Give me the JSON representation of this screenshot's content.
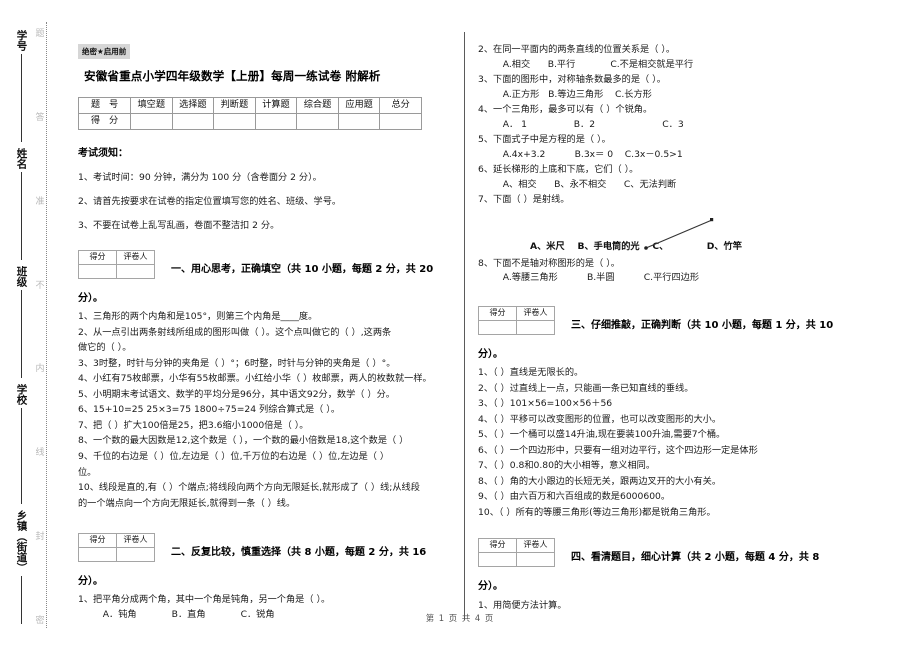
{
  "seal": {
    "faint_chars": [
      "密",
      "封",
      "线",
      "内",
      "不",
      "准",
      "答",
      "题"
    ],
    "fields": [
      {
        "label": "学号"
      },
      {
        "label": "姓名"
      },
      {
        "label": "班级"
      },
      {
        "label": "学校"
      },
      {
        "label": "乡镇（街道）"
      }
    ]
  },
  "header": {
    "secret_badge": "绝密★启用前",
    "title": "安徽省重点小学四年级数学【上册】每周一练试卷 附解析"
  },
  "score_table": {
    "row1_head": "题  号",
    "row2_head": "得  分",
    "columns": [
      "填空题",
      "选择题",
      "判断题",
      "计算题",
      "综合题",
      "应用题",
      "总分"
    ]
  },
  "notice": {
    "title": "考试须知：",
    "items": [
      "1、考试时间：90 分钟，满分为 100 分（含卷面分 2 分）。",
      "2、请首先按要求在试卷的指定位置填写您的姓名、班级、学号。",
      "3、不要在试卷上乱写乱画，卷面不整洁扣 2 分。"
    ]
  },
  "grader_box": {
    "score_label": "得分",
    "marker_label": "评卷人"
  },
  "sections": {
    "s1": {
      "title_line1": "一、用心思考，正确填空（共 10 小题，每题 2 分，共 20",
      "title_line2": "分）。",
      "questions": [
        "1、三角形的两个内角和是105°，则第三个内角是____度。",
        "2、从一点引出两条射线所组成的图形叫做（    ）。这个点叫做它的（    ）,这两条",
        "做它的（    ）。",
        "3、3时整，时针与分钟的夹角是（    ）°；6时整，时针与分钟的夹角是（    ）°。",
        "4、小红有75枚邮票，小华有55枚邮票。小红给小华（    ）枚邮票，两人的枚数就一样。",
        "5、小明期末考试语文、数学的平均分是96分，其中语文92分，数学（    ）分。",
        "6、15+10=25   25×3=75   1800÷75=24   列综合算式是（              ）。",
        "7、把（    ）扩大100倍是25，把3.6缩小1000倍是（    ）。",
        "8、一个数的最大因数是12,这个数是（    ），一个数的最小倍数是18,这个数是（    ）",
        "9、千位的右边是（    ）位,左边是（    ）位,千万位的右边是（    ）位,左边是（    ）",
        "位。",
        "10、线段是直的,有（    ）个端点;将线段向两个方向无限延长,就形成了（    ）线;从线段",
        "的一个端点向一个方向无限延长,就得到一条（    ）线。"
      ]
    },
    "s2": {
      "title_line1": "二、反复比较，慎重选择（共 8 小题，每题 2 分，共 16",
      "title_line2": "分）。",
      "q1": "1、把平角分成两个角，其中一个角是钝角，另一个角是（    ）。",
      "q1_opts": "   A．钝角            B．直角            C．锐角",
      "q2": "2、在同一平面内的两条直线的位置关系是（    ）。",
      "q2_opts": "   A.相交      B.平行            C.不是相交就是平行",
      "q3": "3、下面的图形中，对称轴条数最多的是（     ）。",
      "q3_opts": "   A.正方形   B.等边三角形    C.长方形",
      "q4": "4、一个三角形，最多可以有（   ）个锐角。",
      "q4_opts": "   A． 1                B．2                       C．3",
      "q5": "5、下面式子中是方程的是（    ）。",
      "q5_opts": "   A.4x+3.2          B.3x＝ 0    C.3x－0.5>1",
      "q6": "6、延长梯形的上底和下底，它们（    ）。",
      "q6_opts": "   A、相交      B、永不相交      C、无法判断",
      "q7": "7、下面（    ）是射线。",
      "q7_opts": "A、米尺    B、手电筒的光    C、            D、竹竿",
      "q8": "8、下面不是轴对称图形的是（    ）。",
      "q8_opts": "   A.等腰三角形          B.半圆          C.平行四边形"
    },
    "s3": {
      "title_line1": "三、仔细推敲，正确判断（共 10 小题，每题 1 分，共 10",
      "title_line2": "分）。",
      "questions": [
        "1、（    ）直线是无限长的。",
        "2、（    ）过直线上一点，只能画一条已知直线的垂线。",
        "3、（    ）101×56=100×56＋56",
        "4、（    ）平移可以改变图形的位置，也可以改变图形的大小。",
        "5、（    ）一个桶可以盛14升油,现在要装100升油,需要7个桶。",
        "6、（    ）一个四边形中，只要有一组对边平行，这个四边形一定是体形",
        "7、（    ）0.8和0.80的大小相等，意义相同。",
        "8、（    ）角的大小跟边的长短无关，跟两边叉开的大小有关。",
        "9、（    ）由六百万和六百组成的数是6000600。",
        "10、（    ）所有的等腰三角形(等边三角形)都是锐角三角形。"
      ]
    },
    "s4": {
      "title_line1": "四、看清题目，细心计算（共 2 小题，每题 4 分，共 8",
      "title_line2": "分）。",
      "q1": "1、用简便方法计算。"
    }
  },
  "footer": {
    "page_text": "第 1 页 共 4 页"
  }
}
